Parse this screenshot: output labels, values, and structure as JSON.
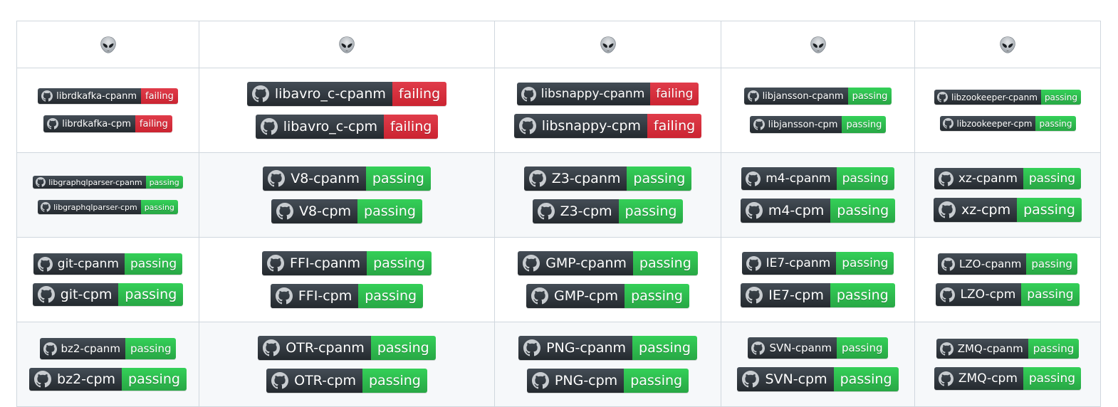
{
  "header_icons": [
    "alien-icon",
    "alien-icon",
    "alien-icon",
    "alien-icon",
    "alien-icon"
  ],
  "colors": {
    "passing": "#2cbe4e",
    "failing": "#cb2431",
    "label_bg": "#2f363d"
  },
  "rows": [
    [
      [
        {
          "name": "librdkafka-cpanm",
          "status": "failing"
        },
        {
          "name": "librdkafka-cpm",
          "status": "failing"
        }
      ],
      [
        {
          "name": "libavro_c-cpanm",
          "status": "failing"
        },
        {
          "name": "libavro_c-cpm",
          "status": "failing"
        }
      ],
      [
        {
          "name": "libsnappy-cpanm",
          "status": "failing"
        },
        {
          "name": "libsnappy-cpm",
          "status": "failing"
        }
      ],
      [
        {
          "name": "libjansson-cpanm",
          "status": "passing"
        },
        {
          "name": "libjansson-cpm",
          "status": "passing"
        }
      ],
      [
        {
          "name": "libzookeeper-cpanm",
          "status": "passing"
        },
        {
          "name": "libzookeeper-cpm",
          "status": "passing"
        }
      ]
    ],
    [
      [
        {
          "name": "libgraphqlparser-cpanm",
          "status": "passing"
        },
        {
          "name": "libgraphqlparser-cpm",
          "status": "passing"
        }
      ],
      [
        {
          "name": "V8-cpanm",
          "status": "passing"
        },
        {
          "name": "V8-cpm",
          "status": "passing"
        }
      ],
      [
        {
          "name": "Z3-cpanm",
          "status": "passing"
        },
        {
          "name": "Z3-cpm",
          "status": "passing"
        }
      ],
      [
        {
          "name": "m4-cpanm",
          "status": "passing"
        },
        {
          "name": "m4-cpm",
          "status": "passing"
        }
      ],
      [
        {
          "name": "xz-cpanm",
          "status": "passing"
        },
        {
          "name": "xz-cpm",
          "status": "passing"
        }
      ]
    ],
    [
      [
        {
          "name": "git-cpanm",
          "status": "passing"
        },
        {
          "name": "git-cpm",
          "status": "passing"
        }
      ],
      [
        {
          "name": "FFI-cpanm",
          "status": "passing"
        },
        {
          "name": "FFI-cpm",
          "status": "passing"
        }
      ],
      [
        {
          "name": "GMP-cpanm",
          "status": "passing"
        },
        {
          "name": "GMP-cpm",
          "status": "passing"
        }
      ],
      [
        {
          "name": "IE7-cpanm",
          "status": "passing"
        },
        {
          "name": "IE7-cpm",
          "status": "passing"
        }
      ],
      [
        {
          "name": "LZO-cpanm",
          "status": "passing"
        },
        {
          "name": "LZO-cpm",
          "status": "passing"
        }
      ]
    ],
    [
      [
        {
          "name": "bz2-cpanm",
          "status": "passing"
        },
        {
          "name": "bz2-cpm",
          "status": "passing"
        }
      ],
      [
        {
          "name": "OTR-cpanm",
          "status": "passing"
        },
        {
          "name": "OTR-cpm",
          "status": "passing"
        }
      ],
      [
        {
          "name": "PNG-cpanm",
          "status": "passing"
        },
        {
          "name": "PNG-cpm",
          "status": "passing"
        }
      ],
      [
        {
          "name": "SVN-cpanm",
          "status": "passing"
        },
        {
          "name": "SVN-cpm",
          "status": "passing"
        }
      ],
      [
        {
          "name": "ZMQ-cpanm",
          "status": "passing"
        },
        {
          "name": "ZMQ-cpm",
          "status": "passing"
        }
      ]
    ]
  ]
}
